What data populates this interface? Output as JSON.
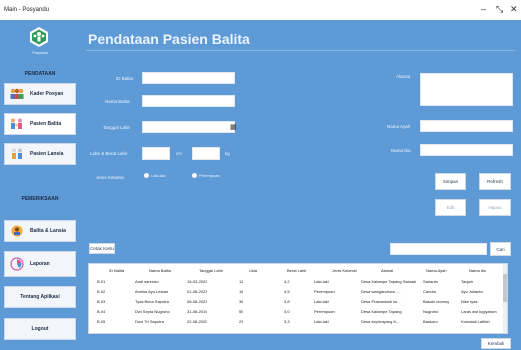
{
  "window": {
    "title": "Main - Posyandu",
    "minimize": "–",
    "restore": "⤡",
    "close": "✕"
  },
  "sidebar": {
    "brand": "Posyandu",
    "section_pendataan": "PENDATAAN",
    "section_pemeriksaan": "PEMERIKSAAN",
    "items": [
      {
        "label": "Kader Posyan"
      },
      {
        "label": "Pasien Balita"
      },
      {
        "label": "Pasien Lansia"
      },
      {
        "label": "Balita & Lansia"
      },
      {
        "label": "Laporan"
      },
      {
        "label": "Tentang Aplikasi"
      },
      {
        "label": "Logout"
      }
    ],
    "colors": {
      "bg": "#5e9bd6",
      "button_bg": "#f2f6fb"
    }
  },
  "main": {
    "title": "Pendataan Pasien Balita",
    "form": {
      "id_balita": "ID Balita",
      "nama_balita": "Nama Balita",
      "tanggal_lahir": "Tanggal Lahir",
      "lahir_berat": "Lahir & Berat Lahir",
      "unit_cm": "cm",
      "unit_kg": "kg",
      "jenis_kelamin": "Jenis Kelamin",
      "laki_laki": "Laki-laki",
      "perempuan": "Perempuan",
      "alamat": "Alamat",
      "nama_ayah": "Nama Ayah",
      "nama_ibu": "Nama Ibu"
    },
    "buttons": {
      "simpan": "Simpan",
      "refresh": "Refresh",
      "edit": "Edit",
      "hapus": "Hapus",
      "cari": "Cari",
      "kembali": "Kembali",
      "cetak": "Cetak Kartu"
    }
  },
  "table": {
    "columns": [
      "ID Balita",
      "Nama Balita",
      "Tanggal Lahir",
      "Usia",
      "Berat Lahir",
      "Jenis Kelamin",
      "Alamat",
      "Nama Ayah",
      "Nama Ibu"
    ],
    "rows": [
      [
        "B.01",
        "Andi sarendo",
        "15-03-2022",
        "12",
        "4,2",
        "Laki-laki",
        "Desa Katampe Tapang Satuadu",
        "Sarianto",
        "Tanjah"
      ],
      [
        "B.02",
        "Annisa Ayu Lestari",
        "01-08-2023",
        "16",
        "4,5",
        "Perempuan",
        "Desa wangandowo ....",
        "Candro",
        "Ayu Julianto"
      ],
      [
        "B.03",
        "Tyas Bima Saputra",
        "08-08-2023",
        "36",
        "3,8",
        "Laki-laki",
        "Desa Prasoedadi no...",
        "Basuki utomoyah",
        "Nike tyas"
      ],
      [
        "B.04",
        "Dwi Septa Nugroho",
        "31-08-2019",
        "55",
        "4,0",
        "Perempuan",
        "Desa Katampe Tapang",
        "Nugroho",
        "Laras dwi lugiyarum"
      ],
      [
        "B.05",
        "Doni Tri Saputra",
        "22-08-2020",
        "29",
        "3,3",
        "Laki-laki",
        "Desa kepirrayang K...",
        "Baskoro",
        "Komalati Latifah"
      ]
    ]
  }
}
